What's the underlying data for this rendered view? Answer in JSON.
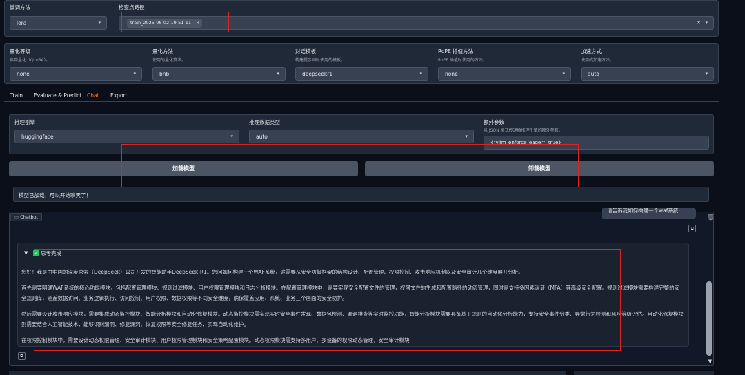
{
  "top_panel": {
    "finetune_label": "微调方法",
    "finetune_value": "lora",
    "checkpoint_label": "检查点路径",
    "checkpoint_tag": "train_2025-06-02-19-51-11",
    "tag_close": "×",
    "clear_icon": "✕",
    "dropdown_arrow": "▾"
  },
  "settings": [
    {
      "label": "量化等级",
      "sub": "启用量化（QLoRA）。",
      "value": "none"
    },
    {
      "label": "量化方法",
      "sub": "使用的量化算法。",
      "value": "bnb"
    },
    {
      "label": "对话模板",
      "sub": "构建提示词时使用的模板。",
      "value": "deepseekr1"
    },
    {
      "label": "RoPE 插值方法",
      "sub": "RoPE 插值时使用的方法。",
      "value": "none"
    },
    {
      "label": "加速方式",
      "sub": "使用的加速方法。",
      "value": "auto"
    }
  ],
  "tabs": [
    "Train",
    "Evaluate & Predict",
    "Chat",
    "Export"
  ],
  "active_tab": "Chat",
  "infer": {
    "engine_label": "推理引擎",
    "engine_value": "huggingface",
    "dtype_label": "推理数据类型",
    "dtype_value": "auto",
    "extra_label": "额外参数",
    "extra_sub": "以 JSON 格式传递给推理引擎的额外参数。",
    "extra_value": "{\"vllm_enforce_eager\": true}"
  },
  "buttons": {
    "load": "加载模型",
    "unload": "卸载模型"
  },
  "status_message": "模型已加载，可以开始聊天了！",
  "chatbot": {
    "label": "Chatbot",
    "user_message": "请告诉我如何构建一个waf系统",
    "thinking_label": "思考完成",
    "paragraphs": [
      "您好！我是由中国的深度求索（DeepSeek）公司开发的智能助手DeepSeek-R1。您问如何构建一个WAF系统，这需要从安全防御框架的结构设计、配置管理、权限控制、攻击响应机制以及安全审计几个维度展开分析。",
      "首先需要明确WAF系统的核心功能模块，包括配置管理模块、规则过滤模块、用户权限管理模块和日志分析模块。在配置管理模块中，需要实现安全配置文件的管理，权限文件的生成和配置路径的动态管理，同时需支持多因素认证（MFA）等高级安全配置。规则过滤模块需要构建完整的安全规则库，涵盖数据访问、业务逻辑执行、访问控制、用户权限、数据权限等不同安全维度，确保覆盖应用、系统、业务三个层面的安全防护。",
      "然后需要设计攻击响应模块，需要集成动态监控模块、智能分析模块和自动化修复模块。动态监控模块需实现实时安全事件发现、数据包检测、漏洞排查等实时监控功能，智能分析模块需要具备基于规则的自动化分析能力，支持安全事件分类、异常行为检测和风险等级评估。自动化修复模块则需要结合人工智能技术，能够识别漏洞、修复漏洞、恢复权限等安全修复任务，实现自动化维护。",
      "在权限控制模块中，需要设计动态权限管理、安全审计模块、用户权限管理模块和安全策略配置模块。动态权限模块需支持多用户、多设备的权限动态管理，安全审计模块"
    ]
  },
  "colors": {
    "accent": "#f97316",
    "red_box": "#e02424",
    "panel": "#1f2937",
    "background": "#0b0f19"
  }
}
